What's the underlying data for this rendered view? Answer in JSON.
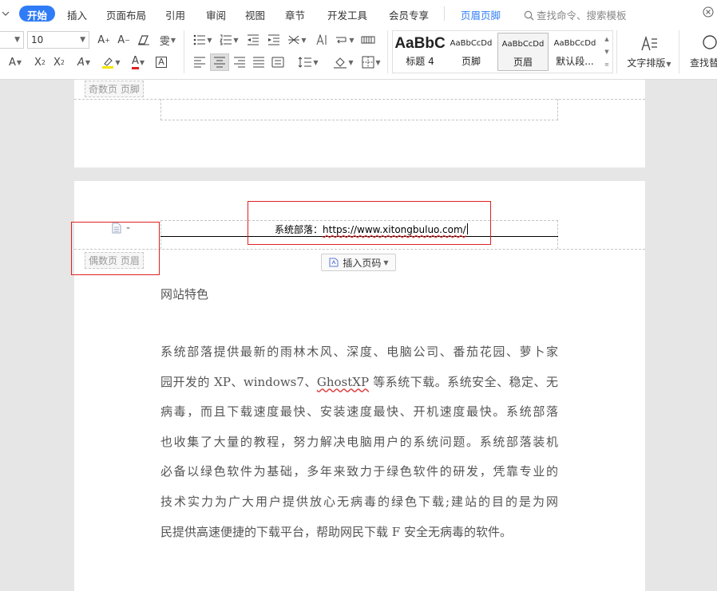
{
  "menubar": {
    "items": [
      "开始",
      "插入",
      "页面布局",
      "引用",
      "审阅",
      "视图",
      "章节",
      "开发工具",
      "会员专享",
      "页眉页脚"
    ],
    "active": "开始",
    "search_placeholder": "查找命令、搜索模板"
  },
  "ribbon": {
    "font_name": "",
    "font_size": "10",
    "styles": [
      {
        "sample": "AaBbC",
        "name": "标题 4"
      },
      {
        "sample": "AaBbCcDd",
        "name": "页脚"
      },
      {
        "sample": "AaBbCcDd",
        "name": "页眉"
      },
      {
        "sample": "AaBbCcDd",
        "name": "默认段..."
      }
    ],
    "text_layout_label": "文字排版",
    "find_replace_label": "查找替"
  },
  "document": {
    "page1_footer_label": "奇数页 页脚",
    "page2_header_label": "偶数页 页眉",
    "header_prefix": "系统部落：",
    "header_url": "https://www.xitongbuluo.com/",
    "insert_page_number_label": "插入页码",
    "heading": "网站特色",
    "paragraph_lines": [
      "系统部落提供最新的雨林木风、深度、电脑公司、番茄花园、萝卜家",
      "园开发的 XP、windows7、GhostXP 等系统下载。系统安全、稳定、无",
      "病毒，而且下载速度最快、安装速度最快、开机速度最快。系统部落",
      "也收集了大量的教程，努力解决电脑用户的系统问题。系统部落装机",
      "必备以绿色软件为基础，多年来致力于绿色软件的研发，凭靠专业的",
      "技术实力为广大用户提供放心无病毒的绿色下载;建站的目的是为网",
      "民提供高速便捷的下载平台，帮助网民下载 F 安全无病毒的软件。"
    ]
  },
  "colors": {
    "accent": "#2f7cf6",
    "highlight_box": "#e02020",
    "spell_underline": "#e04040"
  }
}
